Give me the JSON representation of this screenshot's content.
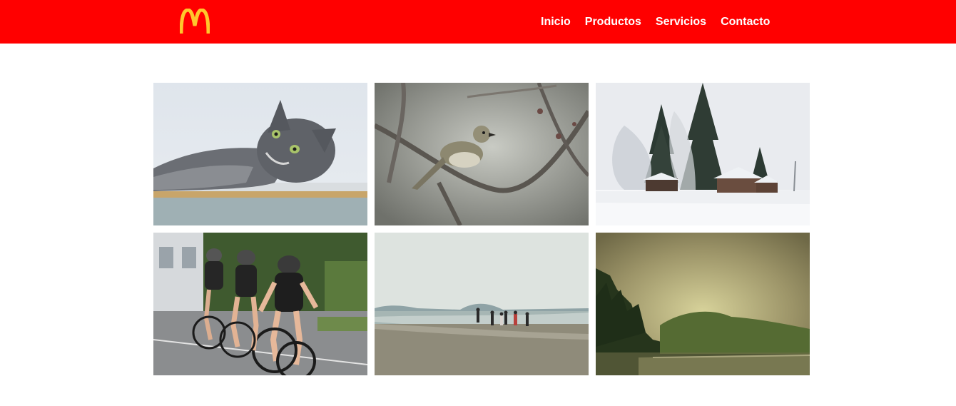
{
  "header": {
    "background_color": "#ff0000",
    "logo": {
      "icon": "golden-arches-logo-icon",
      "color": "#ffc72c"
    },
    "nav": [
      {
        "label": "Inicio"
      },
      {
        "label": "Productos"
      },
      {
        "label": "Servicios"
      },
      {
        "label": "Contacto"
      }
    ]
  },
  "gallery": {
    "photos": [
      {
        "subject": "gray-cat"
      },
      {
        "subject": "bird-on-branch"
      },
      {
        "subject": "snowy-cabin-forest"
      },
      {
        "subject": "cyclists-racing"
      },
      {
        "subject": "misty-beach"
      },
      {
        "subject": "foggy-forest-lake"
      }
    ]
  }
}
